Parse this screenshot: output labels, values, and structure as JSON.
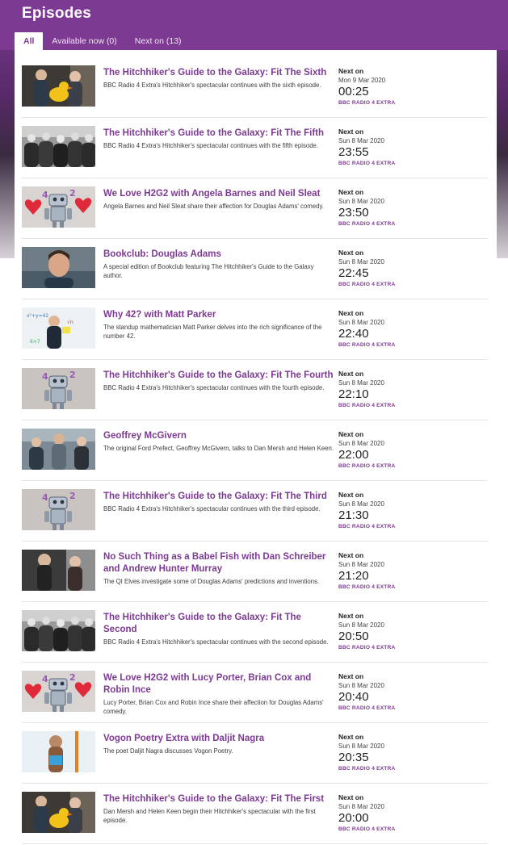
{
  "header": {
    "title": "Episodes"
  },
  "tabs": [
    {
      "label": "All",
      "active": true
    },
    {
      "label": "Available now (0)",
      "active": false
    },
    {
      "label": "Next on (13)",
      "active": false
    }
  ],
  "episodes": [
    {
      "title": "The Hitchhiker's Guide to the Galaxy: Fit The Sixth",
      "desc": "BBC Radio 4 Extra's Hitchhiker's spectacular continues with the sixth episode.",
      "next_label": "Next on",
      "date": "Mon 9 Mar 2020",
      "time": "00:25",
      "network": "BBC RADIO 4 EXTRA",
      "thumb": "duck-photo"
    },
    {
      "title": "The Hitchhiker's Guide to the Galaxy: Fit The Fifth",
      "desc": "BBC Radio 4 Extra's Hitchhiker's spectacular continues with the fifth episode.",
      "next_label": "Next on",
      "date": "Sun 8 Mar 2020",
      "time": "23:55",
      "network": "BBC RADIO 4 EXTRA",
      "thumb": "bw-group"
    },
    {
      "title": "We Love H2G2 with Angela Barnes and Neil Sleat",
      "desc": "Angela Barnes and Neil Sleat share their affection for Douglas Adams' comedy.",
      "next_label": "Next on",
      "date": "Sun 8 Mar 2020",
      "time": "23:50",
      "network": "BBC RADIO 4 EXTRA",
      "thumb": "robot-hearts"
    },
    {
      "title": "Bookclub: Douglas Adams",
      "desc": "A special edition of Bookclub featuring The Hitchhiker's Guide to the Galaxy author.",
      "next_label": "Next on",
      "date": "Sun 8 Mar 2020",
      "time": "22:45",
      "network": "BBC RADIO 4 EXTRA",
      "thumb": "portrait"
    },
    {
      "title": "Why 42? with Matt Parker",
      "desc": "The standup mathematician Matt Parker delves into the rich significance of the number 42.",
      "next_label": "Next on",
      "date": "Sun 8 Mar 2020",
      "time": "22:40",
      "network": "BBC RADIO 4 EXTRA",
      "thumb": "whiteboard"
    },
    {
      "title": "The Hitchhiker's Guide to the Galaxy: Fit The Fourth",
      "desc": "BBC Radio 4 Extra's Hitchhiker's spectacular continues with the fourth episode.",
      "next_label": "Next on",
      "date": "Sun 8 Mar 2020",
      "time": "22:10",
      "network": "BBC RADIO 4 EXTRA",
      "thumb": "robot"
    },
    {
      "title": "Geoffrey McGivern",
      "desc": "The original Ford Prefect, Geoffrey McGivern, talks to Dan Mersh and Helen Keen.",
      "next_label": "Next on",
      "date": "Sun 8 Mar 2020",
      "time": "22:00",
      "network": "BBC RADIO 4 EXTRA",
      "thumb": "trio"
    },
    {
      "title": "The Hitchhiker's Guide to the Galaxy: Fit The Third",
      "desc": "BBC Radio 4 Extra's Hitchhiker's spectacular continues with the third episode.",
      "next_label": "Next on",
      "date": "Sun 8 Mar 2020",
      "time": "21:30",
      "network": "BBC RADIO 4 EXTRA",
      "thumb": "robot"
    },
    {
      "title": "No Such Thing as a Babel Fish with Dan Schreiber and Andrew Hunter Murray",
      "desc": "The QI Elves investigate some of Douglas Adams' predictions and inventions.",
      "next_label": "Next on",
      "date": "Sun 8 Mar 2020",
      "time": "21:20",
      "network": "BBC RADIO 4 EXTRA",
      "thumb": "duo"
    },
    {
      "title": "The Hitchhiker's Guide to the Galaxy: Fit The Second",
      "desc": "BBC Radio 4 Extra's Hitchhiker's spectacular continues with the second episode.",
      "next_label": "Next on",
      "date": "Sun 8 Mar 2020",
      "time": "20:50",
      "network": "BBC RADIO 4 EXTRA",
      "thumb": "bw-group"
    },
    {
      "title": "We Love H2G2 with Lucy Porter, Brian Cox and Robin Ince",
      "desc": "Lucy Porter, Brian Cox and Robin Ince share their affection for Douglas Adams' comedy.",
      "next_label": "Next on",
      "date": "Sun 8 Mar 2020",
      "time": "20:40",
      "network": "BBC RADIO 4 EXTRA",
      "thumb": "robot-hearts"
    },
    {
      "title": "Vogon Poetry Extra with Daljit Nagra",
      "desc": "The poet Daljit Nagra discusses Vogon Poetry.",
      "next_label": "Next on",
      "date": "Sun 8 Mar 2020",
      "time": "20:35",
      "network": "BBC RADIO 4 EXTRA",
      "thumb": "poet"
    },
    {
      "title": "The Hitchhiker's Guide to the Galaxy: Fit The First",
      "desc": "Dan Mersh and Helen Keen begin their Hitchhiker's spectacular with the first episode.",
      "next_label": "Next on",
      "date": "Sun 8 Mar 2020",
      "time": "20:00",
      "network": "BBC RADIO 4 EXTRA",
      "thumb": "duck-photo"
    }
  ]
}
